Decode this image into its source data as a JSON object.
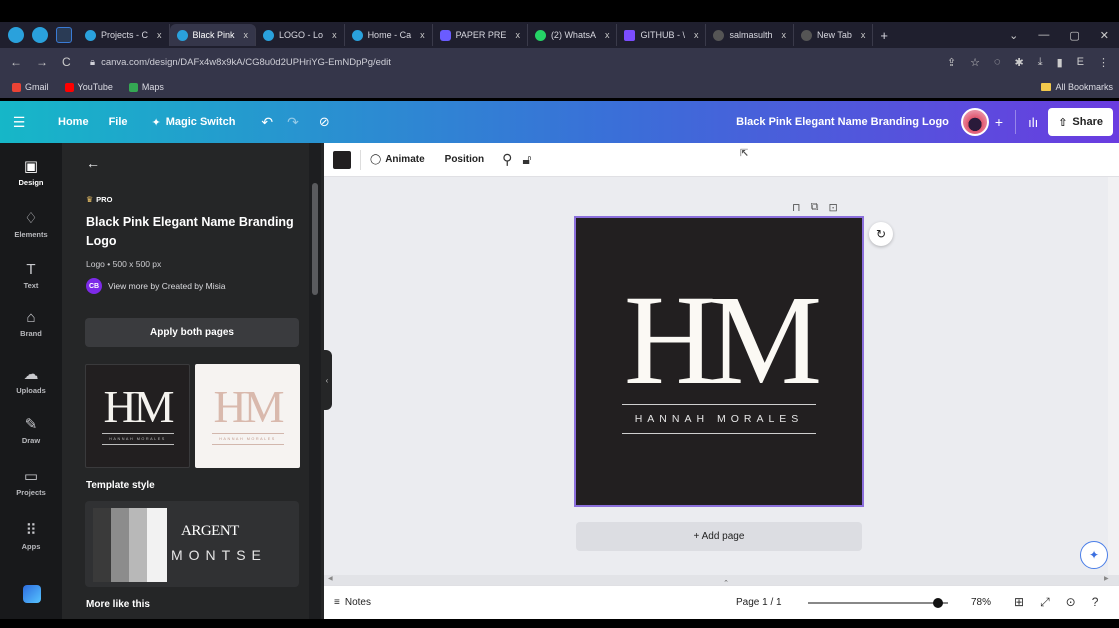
{
  "browser": {
    "tabs": [
      {
        "label": "Projects - C",
        "fav": ""
      },
      {
        "label": "Black Pink",
        "fav": "",
        "active": true
      },
      {
        "label": "LOGO - Lo",
        "fav": ""
      },
      {
        "label": "Home - Ca",
        "fav": ""
      },
      {
        "label": "PAPER PRE",
        "fav": "heart"
      },
      {
        "label": "(2) WhatsA",
        "fav": "green"
      },
      {
        "label": "GITHUB - \\",
        "fav": "purple"
      },
      {
        "label": "salmasulth",
        "fav": "gray"
      },
      {
        "label": "New Tab",
        "fav": "gray"
      }
    ],
    "close_glyph": "x",
    "new_tab_glyph": "+",
    "url": "canva.com/design/DAFx4w8x9kA/CG8u0d2UPHriYG-EmNDpPg/edit",
    "bookmarks": [
      {
        "label": "Gmail",
        "color": "#ea4335"
      },
      {
        "label": "YouTube",
        "color": "#ff0000"
      },
      {
        "label": "Maps",
        "color": "#34a853"
      }
    ],
    "all_bookmarks": "All Bookmarks"
  },
  "header": {
    "home": "Home",
    "file": "File",
    "magic_switch": "Magic Switch",
    "design_title": "Black Pink Elegant Name Branding Logo",
    "share": "Share"
  },
  "rail": {
    "items": [
      {
        "label": "Design",
        "icon": "▣"
      },
      {
        "label": "Elements",
        "icon": "♢"
      },
      {
        "label": "Text",
        "icon": "T"
      },
      {
        "label": "Brand",
        "icon": "⌂"
      },
      {
        "label": "Uploads",
        "icon": "☁"
      },
      {
        "label": "Draw",
        "icon": "✎"
      },
      {
        "label": "Projects",
        "icon": "▭"
      },
      {
        "label": "Apps",
        "icon": "⠿"
      }
    ]
  },
  "panel": {
    "pro_badge": "PRO",
    "title": "Black Pink Elegant Name Branding Logo",
    "meta": "Logo • 500 x 500 px",
    "author_initials": "CB",
    "author_text": "View more by Created by Misia",
    "apply_button": "Apply both pages",
    "thumb_monogram": "HM",
    "thumb_name": "HANNAH MORALES",
    "template_style_label": "Template style",
    "style_font_1": "ARGENT",
    "style_font_2": "MONTSE",
    "more_like_this": "More like this",
    "swatches": [
      "#3a3a3a",
      "#8c8c8c",
      "#b8b8b8",
      "#f2f2f2"
    ]
  },
  "toolbar": {
    "animate": "Animate",
    "position": "Position",
    "color": "#221f20"
  },
  "canvas": {
    "monogram": "HM",
    "name": "HANNAH MORALES",
    "add_page": "+ Add page",
    "background": "#221f20",
    "selection_color": "#8b6fdc"
  },
  "footer": {
    "notes": "Notes",
    "page_indicator": "Page 1 / 1",
    "zoom_percent": "78%",
    "zoom_value": 0.78
  }
}
